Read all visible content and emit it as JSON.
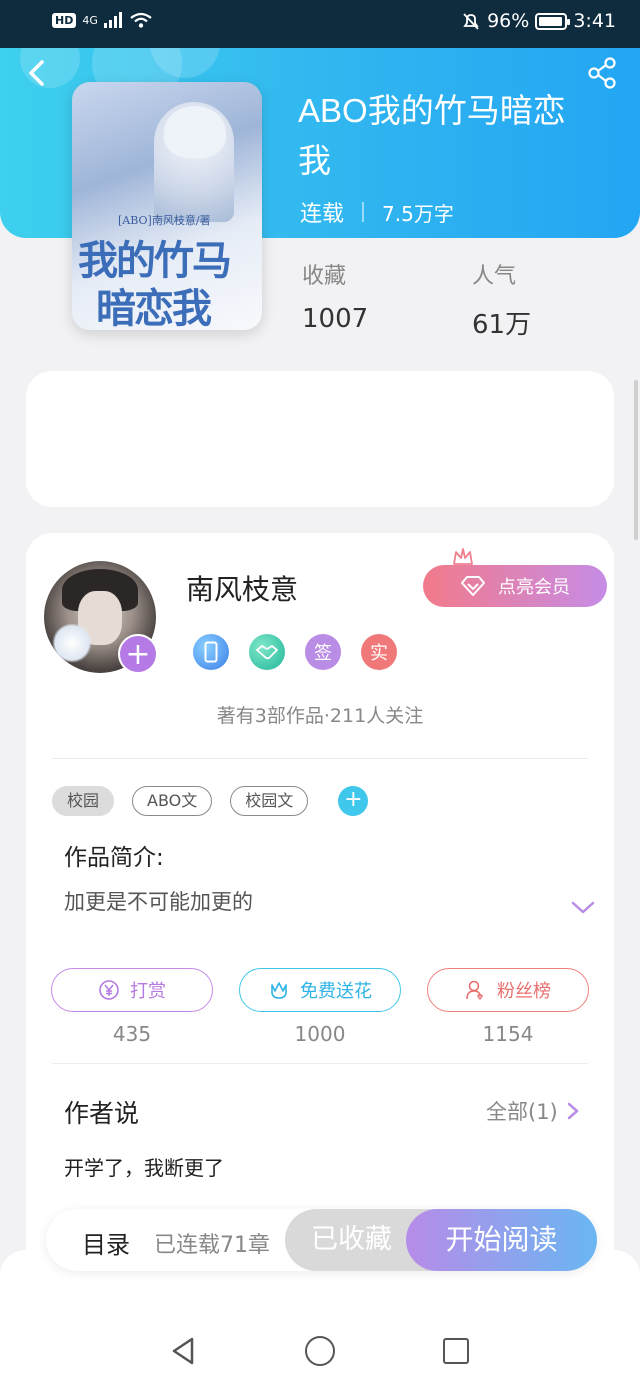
{
  "status_bar": {
    "hd": "HD",
    "network": "4G",
    "battery_pct": "96%",
    "time": "3:41"
  },
  "book": {
    "title": "ABO我的竹马暗恋我",
    "status": "连载",
    "word_count": "7.5万字",
    "cover": {
      "top_line": "[ABO]南风枝意/著",
      "big_line1": "我的竹马",
      "big_line2": "暗恋我"
    },
    "stats": [
      {
        "label": "收藏",
        "value": "1007"
      },
      {
        "label": "人气",
        "value": "61万"
      }
    ]
  },
  "author": {
    "name": "南风枝意",
    "member_button": "点亮会员",
    "badges": [
      {
        "icon": "phone-badge-icon",
        "text": ""
      },
      {
        "icon": "handshake-badge-icon",
        "text": ""
      },
      {
        "icon": "sign-badge-icon",
        "text": "签"
      },
      {
        "icon": "real-name-badge-icon",
        "text": "实"
      }
    ],
    "works_line": "著有3部作品·211人关注"
  },
  "tags": [
    "校园",
    "ABO文",
    "校园文"
  ],
  "intro": {
    "label": "作品简介:",
    "text": "加更是不可能加更的"
  },
  "actions": [
    {
      "label": "打赏",
      "count": "435",
      "icon": "yen-icon"
    },
    {
      "label": "免费送花",
      "count": "1000",
      "icon": "flower-icon"
    },
    {
      "label": "粉丝榜",
      "count": "1154",
      "icon": "fans-icon"
    }
  ],
  "author_says": {
    "title": "作者说",
    "all_label": "全部(1)",
    "note": "开学了，我断更了"
  },
  "bottom_bar": {
    "toc": "目录",
    "serial": "已连载71章",
    "collected": "已收藏",
    "read": "开始阅读"
  },
  "colors": {
    "header_start": "#3ed0ee",
    "header_end": "#23a6f3",
    "accent_purple": "#b57ae6",
    "accent_cyan": "#3fc7ec",
    "accent_red": "#f07878"
  }
}
